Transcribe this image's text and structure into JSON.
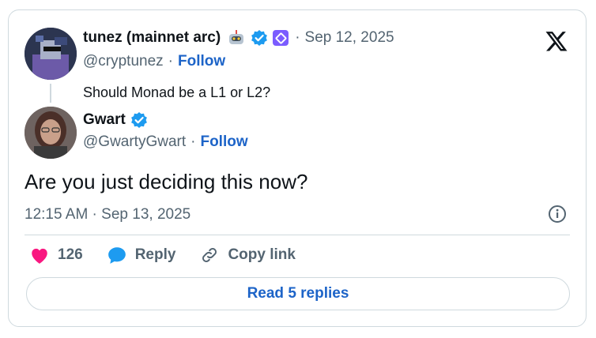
{
  "parent": {
    "display_name": "tunez (mainnet arc)",
    "handle": "@cryptunez",
    "date": "Sep 12, 2025",
    "follow_label": "Follow",
    "separator": "·",
    "text": "Should Monad be a L1 or L2?",
    "icons": [
      "robot-emoji-icon",
      "verified-badge-icon",
      "affiliate-badge-icon"
    ]
  },
  "reply": {
    "display_name": "Gwart",
    "handle": "@GwartyGwart",
    "follow_label": "Follow",
    "separator": "·",
    "text": "Are you just deciding this now?",
    "timestamp": "12:15 AM · Sep 13, 2025",
    "icons": [
      "verified-badge-icon"
    ]
  },
  "actions": {
    "likes_count": "126",
    "reply_label": "Reply",
    "copy_link_label": "Copy link"
  },
  "read_replies_label": "Read 5 replies",
  "colors": {
    "accent": "#1d64c8",
    "verified": "#1d9bf0",
    "heart": "#f91880",
    "muted": "#536471",
    "border": "#cfd9de"
  }
}
